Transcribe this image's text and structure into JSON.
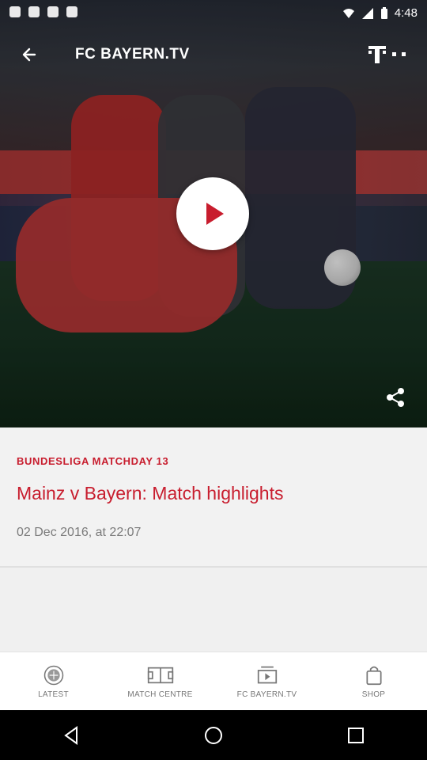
{
  "status_bar": {
    "time": "4:48"
  },
  "header": {
    "title": "FC BAYERN.TV"
  },
  "article": {
    "category": "BUNDESLIGA MATCHDAY 13",
    "headline": "Mainz v Bayern: Match highlights",
    "date": "02 Dec 2016, at 22:07"
  },
  "bottom_nav": {
    "items": [
      {
        "label": "LATEST",
        "icon": "bayern-crest-icon"
      },
      {
        "label": "MATCH CENTRE",
        "icon": "pitch-icon"
      },
      {
        "label": "FC BAYERN.TV",
        "icon": "video-play-icon"
      },
      {
        "label": "SHOP",
        "icon": "shopping-bag-icon"
      }
    ]
  },
  "colors": {
    "accent": "#c81d2e",
    "nav_bg": "#ffffff",
    "system_nav": "#000000"
  }
}
